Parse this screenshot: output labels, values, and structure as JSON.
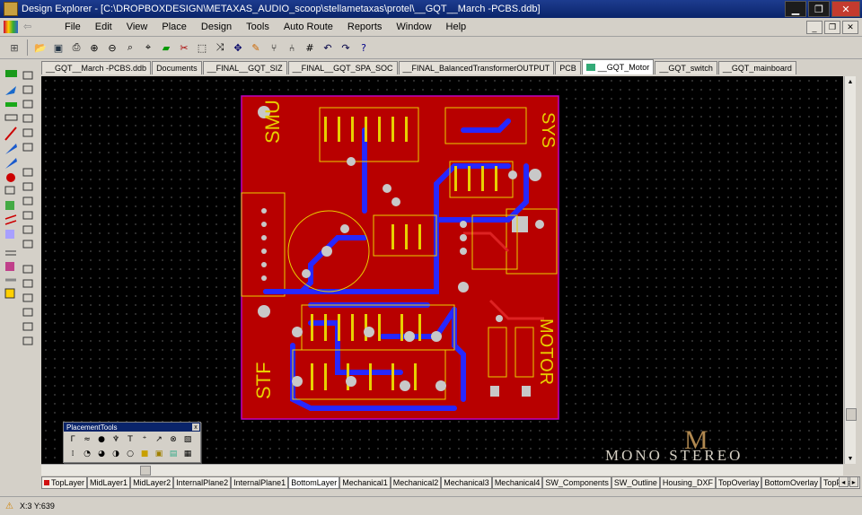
{
  "window": {
    "title": "Design Explorer - [C:\\DROPBOXDESIGN\\METAXAS_AUDIO_scoop\\stellametaxas\\protel\\__GQT__March -PCBS.ddb]",
    "minimize": "▁",
    "restore": "❐",
    "close": "✕"
  },
  "menu": {
    "items": [
      "File",
      "Edit",
      "View",
      "Place",
      "Design",
      "Tools",
      "Auto Route",
      "Reports",
      "Window",
      "Help"
    ]
  },
  "toolbar": {
    "icons": [
      "design-manager-icon",
      "open-icon",
      "save-icon",
      "print-icon",
      "zoom-in-icon",
      "zoom-out-icon",
      "zoom-area-icon",
      "zoom-fit-icon",
      "place-component-icon",
      "cut-icon",
      "select-icon",
      "deselect-icon",
      "move-icon",
      "cross-probe-icon",
      "browse-library-icon",
      "component-icon",
      "grid-icon",
      "undo-icon",
      "redo-icon",
      "help-icon"
    ]
  },
  "doc_tabs": [
    {
      "label": "__GQT__March -PCBS.ddb",
      "active": false
    },
    {
      "label": "Documents",
      "active": false
    },
    {
      "label": "__FINAL__GQT_SIZ",
      "active": false
    },
    {
      "label": "__FINAL__GQT_SPA_SOC",
      "active": false
    },
    {
      "label": "__FINAL_BalancedTransformerOUTPUT",
      "active": false
    },
    {
      "label": "PCB",
      "active": false
    },
    {
      "label": "__GQT_Motor",
      "active": true
    },
    {
      "label": "__GQT_switch",
      "active": false
    },
    {
      "label": "__GQT_mainboard",
      "active": false
    }
  ],
  "layer_tabs": [
    {
      "label": "TopLayer",
      "color": "#d01010",
      "active": false
    },
    {
      "label": "MidLayer1",
      "color": "#c0c0c0",
      "active": false
    },
    {
      "label": "MidLayer2",
      "color": "#c0c0c0",
      "active": false
    },
    {
      "label": "InternalPlane2",
      "color": "#00a000",
      "active": false
    },
    {
      "label": "InternalPlane1",
      "color": "#00a000",
      "active": false
    },
    {
      "label": "BottomLayer",
      "color": "#2020e0",
      "active": true
    },
    {
      "label": "Mechanical1",
      "color": "#c000c0",
      "active": false
    },
    {
      "label": "Mechanical2",
      "color": "#c000c0",
      "active": false
    },
    {
      "label": "Mechanical3",
      "color": "#c000c0",
      "active": false
    },
    {
      "label": "Mechanical4",
      "color": "#c000c0",
      "active": false
    },
    {
      "label": "SW_Components",
      "color": "#c000c0",
      "active": false
    },
    {
      "label": "SW_Outline",
      "color": "#c000c0",
      "active": false
    },
    {
      "label": "Housing_DXF",
      "color": "#c000c0",
      "active": false
    },
    {
      "label": "TopOverlay",
      "color": "#e0e000",
      "active": false
    },
    {
      "label": "BottomOverlay",
      "color": "#a08000",
      "active": false
    },
    {
      "label": "TopPaste",
      "color": "#808080",
      "active": false
    }
  ],
  "palette": {
    "title": "PlacementTools",
    "close": "x",
    "tools": [
      "line-icon",
      "track-icon",
      "via-icon",
      "pad-icon",
      "text-icon",
      "coordinate-icon",
      "dimension-icon",
      "origin-icon",
      "arc-icon",
      "arc-edge-icon",
      "arc-center-icon",
      "circle-icon",
      "fill-icon",
      "polygon-icon",
      "component-icon",
      "room-icon"
    ]
  },
  "pcb": {
    "silk_left_top": "SMU",
    "silk_left_bottom": "STF",
    "silk_right_top": "SYS",
    "silk_right_bottom": "MOTOR",
    "colors": {
      "board": "#b80000",
      "copper_bottom": "#2727ff",
      "copper_top": "#dd2222",
      "silk": "#e8d000",
      "via": "#c8c8c8",
      "outline": "#c000c0"
    }
  },
  "status": {
    "coords": "X:3 Y:639"
  },
  "watermark": {
    "mark": "M",
    "text": "MONO STEREO"
  }
}
